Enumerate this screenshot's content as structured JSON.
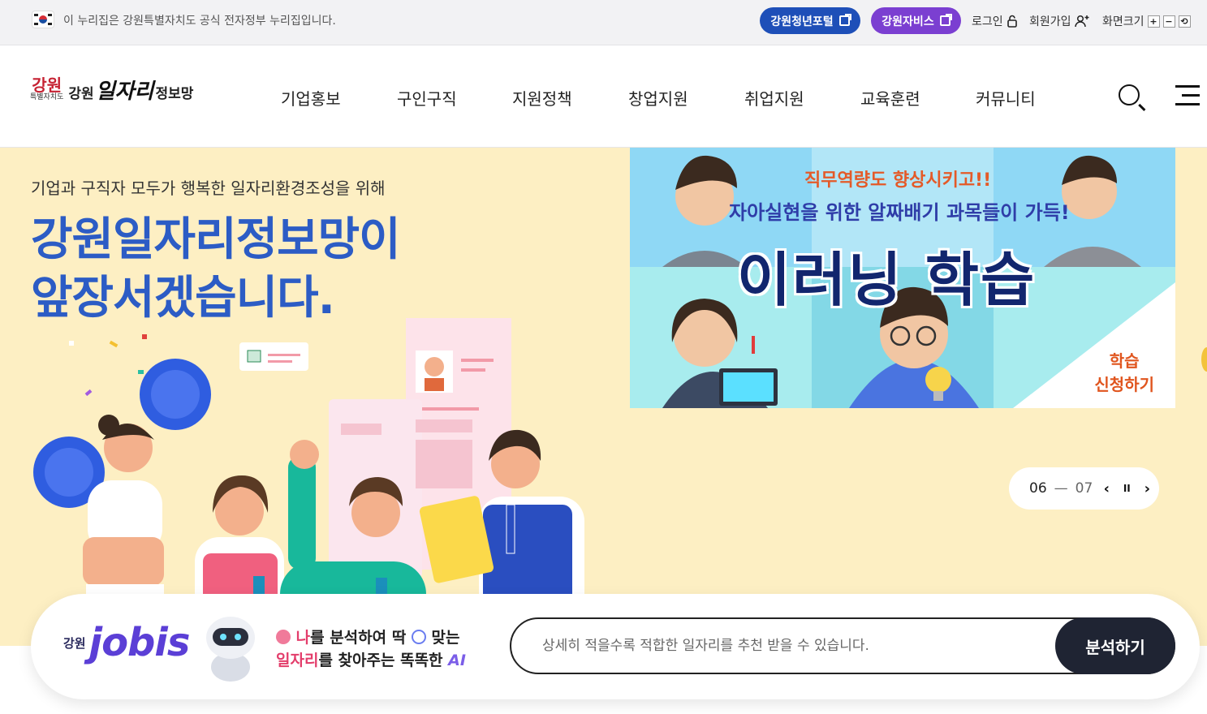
{
  "topbar": {
    "gov_notice": "이 누리집은 강원특별자치도 공식 전자정부 누리집입니다.",
    "youth_portal": "강원청년포털",
    "jobis": "강원자비스",
    "login": "로그인",
    "join": "회원가입",
    "zoom_label": "화면크기",
    "zoom_in": "+",
    "zoom_out": "−",
    "zoom_reset": "⟲"
  },
  "header": {
    "logo_mark": "강원",
    "logo_sub": "특별자치도",
    "logo_prefix": "강원",
    "logo_big": "일자리",
    "logo_suffix": "정보망",
    "nav": [
      "기업홍보",
      "구인구직",
      "지원정책",
      "창업지원",
      "취업지원",
      "교육훈련",
      "커뮤니티"
    ]
  },
  "hero": {
    "subtitle": "기업과 구직자 모두가 행복한 일자리환경조성을 위해",
    "title_line1": "강원일자리정보망이",
    "title_line2": "앞장서겠습니다."
  },
  "banner": {
    "line1": "직무역량도 향상시키고!!",
    "line2": "자아실현을 위한 알짜배기 과목들이 가득!",
    "main": "이러닝 학습",
    "apply_line1": "학습",
    "apply_line2": "신청하기"
  },
  "pager": {
    "current": "06",
    "separator": "—",
    "total": "07",
    "prev": "‹",
    "pause": "II",
    "next": "›"
  },
  "ai": {
    "logo_prefix": "강원",
    "logo": "jobis",
    "msg_red1": "나",
    "msg_rest1": "를 분석하여 딱",
    "msg_rest1b": " 맞는",
    "msg_red2": "일자리",
    "msg_rest2": "를 찾아주는 똑똑한 ",
    "msg_ai": "AI",
    "placeholder": "상세히 적을수록 적합한 일자리를 추천 받을 수 있습니다.",
    "button": "분석하기"
  },
  "colors": {
    "primary_blue": "#2c5cc5",
    "hero_bg": "#fdefc3",
    "youth_pill": "#1e4fb8",
    "jobis_pill": "#7b3fd1",
    "button_dark": "#1f2433"
  }
}
